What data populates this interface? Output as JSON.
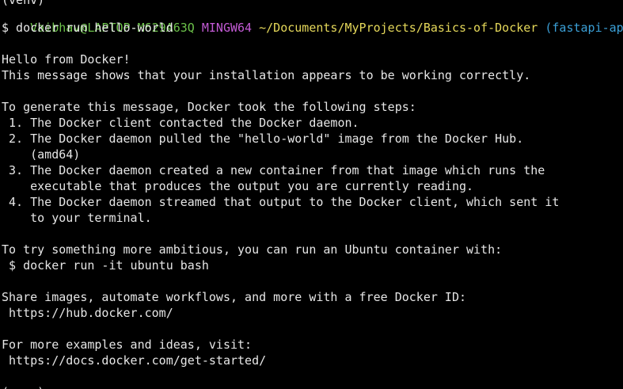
{
  "colors": {
    "background": "#000000",
    "text": "#e6e6e6",
    "user_host": "#6cc24a",
    "shell_name": "#c45bd6",
    "path": "#e5d85a",
    "branch": "#3b9fd6"
  },
  "terminal": {
    "top_partial": "(venv)",
    "prompt": {
      "user_host": "Vaibhav@LAPTOP-M629A63Q",
      "shell": "MINGW64",
      "path": "~/Documents/MyProjects/Basics-of-Docker",
      "branch": "(fastapi-app)"
    },
    "command": "$ docker run hello-world",
    "output": [
      "",
      "Hello from Docker!",
      "This message shows that your installation appears to be working correctly.",
      "",
      "To generate this message, Docker took the following steps:",
      " 1. The Docker client contacted the Docker daemon.",
      " 2. The Docker daemon pulled the \"hello-world\" image from the Docker Hub.",
      "    (amd64)",
      " 3. The Docker daemon created a new container from that image which runs the",
      "    executable that produces the output you are currently reading.",
      " 4. The Docker daemon streamed that output to the Docker client, which sent it",
      "    to your terminal.",
      "",
      "To try something more ambitious, you can run an Ubuntu container with:",
      " $ docker run -it ubuntu bash",
      "",
      "Share images, automate workflows, and more with a free Docker ID:",
      " https://hub.docker.com/",
      "",
      "For more examples and ideas, visit:",
      " https://docs.docker.com/get-started/",
      "",
      "(venv)"
    ]
  }
}
